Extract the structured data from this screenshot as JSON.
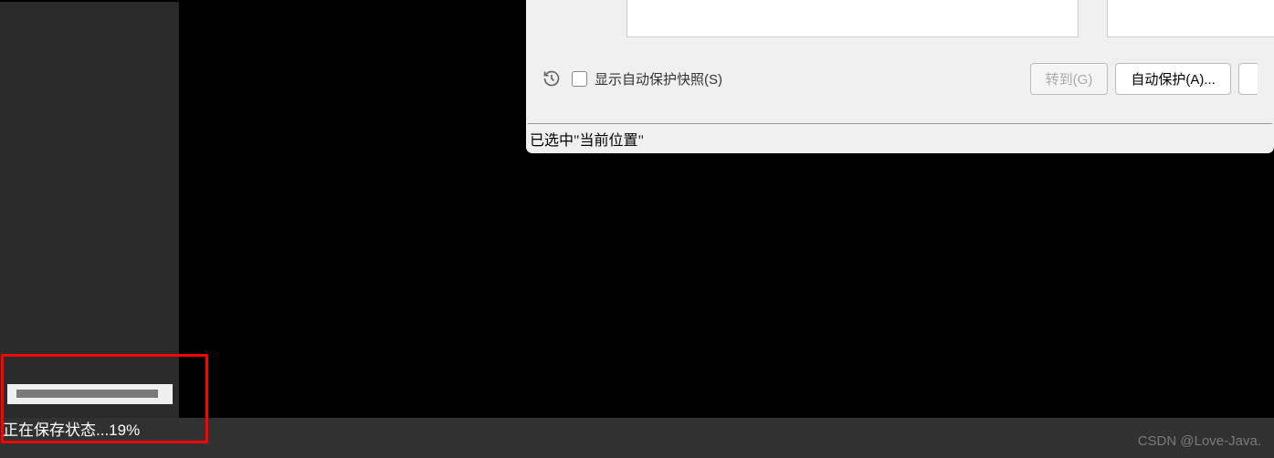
{
  "dialog": {
    "checkbox_label": "显示自动保护快照(S)",
    "goto_button": "转到(G)",
    "auto_protect_button": "自动保护(A)...",
    "status_message": "已选中\"当前位置\""
  },
  "progress": {
    "status_text": "正在保存状态...19%"
  },
  "watermark": "CSDN @Love-Java."
}
